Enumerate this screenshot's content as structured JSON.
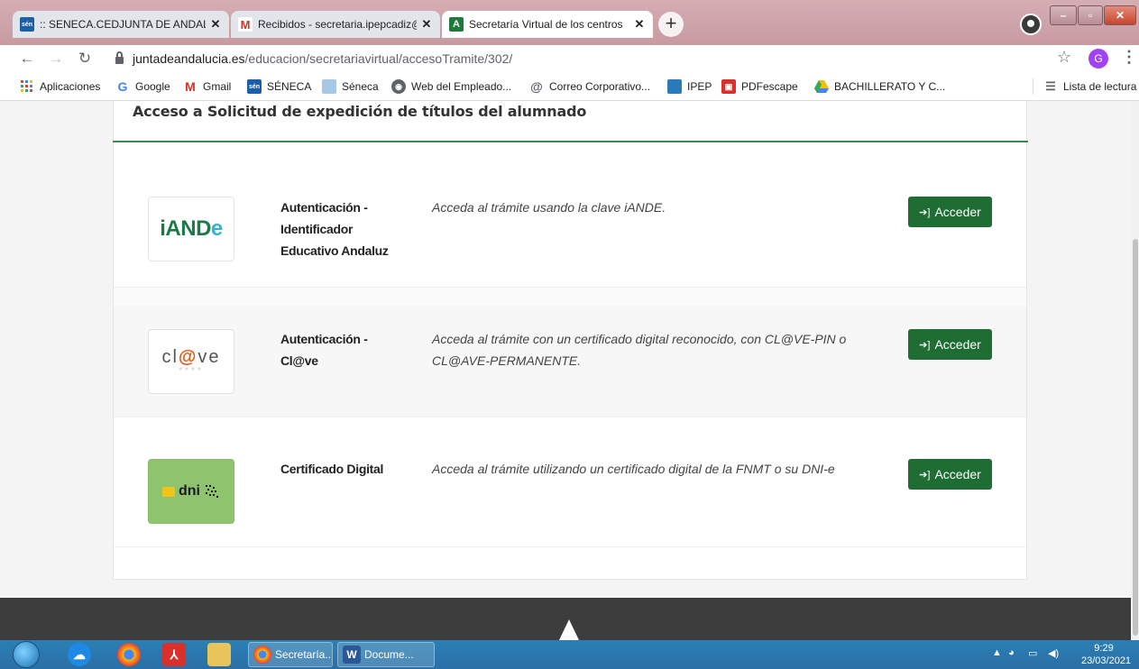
{
  "browser": {
    "tabs": [
      {
        "title": ":: SENECA.CEDJUNTA DE ANDAL",
        "favicon": "seneca-icon",
        "active": false
      },
      {
        "title": "Recibidos - secretaria.ipepcadiz@",
        "favicon": "gmail-icon",
        "active": false
      },
      {
        "title": "Secretaría Virtual de los centros",
        "favicon": "junta-andalucia-icon",
        "active": true
      }
    ],
    "address": {
      "host": "juntadeandalucia.es",
      "path": "/educacion/secretariavirtual/accesoTramite/302/"
    },
    "profile_initial": "G",
    "bookmarks": [
      {
        "label": "Aplicaciones",
        "icon": "apps-grid-icon"
      },
      {
        "label": "Google",
        "icon": "google-icon"
      },
      {
        "label": "Gmail",
        "icon": "gmail-icon"
      },
      {
        "label": "SÉNECA",
        "icon": "seneca-icon"
      },
      {
        "label": "Séneca",
        "icon": "seneca-doc-icon"
      },
      {
        "label": "Web del Empleado...",
        "icon": "globe-icon"
      },
      {
        "label": "Correo Corporativo...",
        "icon": "at-icon"
      },
      {
        "label": "IPEP",
        "icon": "ipep-icon"
      },
      {
        "label": "PDFescape",
        "icon": "pdfescape-icon"
      },
      {
        "label": "BACHILLERATO Y C...",
        "icon": "drive-icon"
      }
    ],
    "reading_list": "Lista de lectura"
  },
  "page": {
    "title": "Acceso a Solicitud de expedición de títulos del alumnado",
    "methods": [
      {
        "logo": "iande-logo",
        "logo_text": "iANDe",
        "name_lines": [
          "Autenticación -",
          "Identificador",
          "Educativo Andaluz"
        ],
        "description": "Acceda al trámite usando la clave iANDE.",
        "button": "Acceder"
      },
      {
        "logo": "clave-logo",
        "logo_text": "cl@ve",
        "name_lines": [
          "Autenticación -",
          "Cl@ve"
        ],
        "description": "Acceda al trámite con un certificado digital reconocido, con CL@VE-PIN o CL@AVE-PERMANENTE.",
        "button": "Acceder"
      },
      {
        "logo": "dni-logo",
        "logo_text": "dni",
        "name_lines": [
          "Certificado Digital"
        ],
        "description": "Acceda al trámite utilizando un certificado digital de la FNMT o su DNI-e",
        "button": "Acceder"
      }
    ]
  },
  "taskbar": {
    "tasks": [
      {
        "label": "Secretaría...",
        "icon": "chrome-icon"
      },
      {
        "label": "Docume...",
        "icon": "word-icon"
      }
    ],
    "time": "9:29",
    "date": "23/03/2021"
  },
  "colors": {
    "accent_green": "#1e6e34",
    "title_line": "#3d8a4a",
    "footer": "#3d3d3d"
  }
}
